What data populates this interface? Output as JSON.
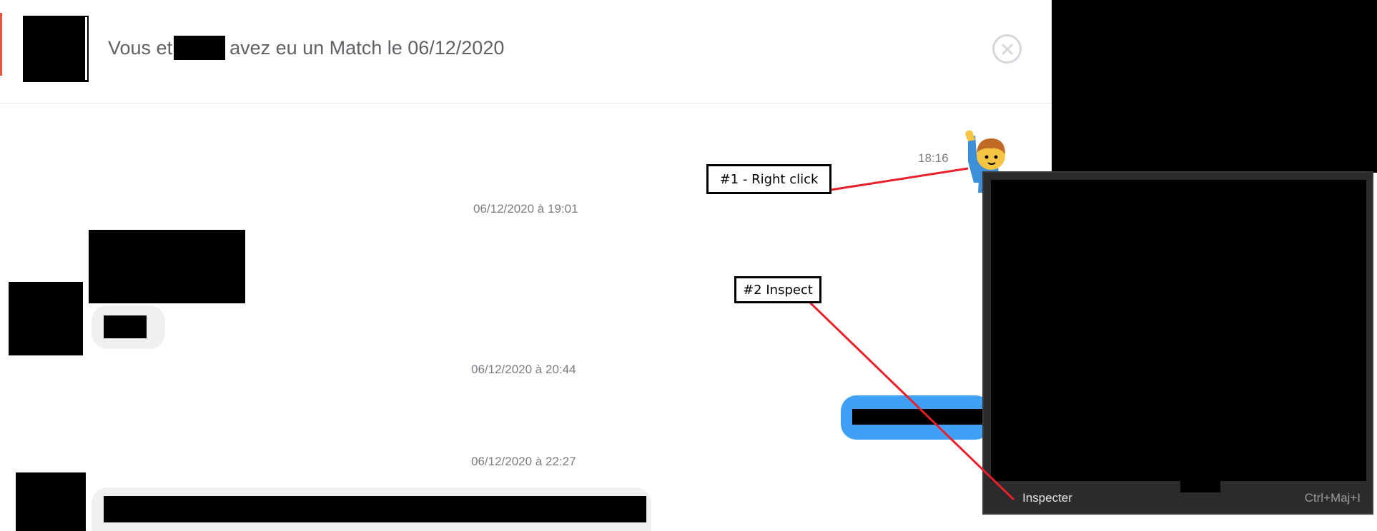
{
  "header": {
    "title_prefix": "Vous et",
    "title_suffix": "avez eu un Match le 06/12/2020"
  },
  "icons": {
    "close": "close-circle-icon",
    "wave": "person-raising-hand-emoji"
  },
  "messages": {
    "sent_time": "18:16",
    "ts1": "06/12/2020 à 19:01",
    "ts2": "06/12/2020 à 20:44",
    "ts3": "06/12/2020 à 22:27"
  },
  "context_menu": {
    "item_label": "Inspecter",
    "item_shortcut": "Ctrl+Maj+I"
  },
  "annotations": {
    "step1": "#1 - Right click",
    "step2": "#2 Inspect"
  },
  "colors": {
    "accent_red": "#e8533f",
    "bubble_blue": "#3fa0f5",
    "bubble_gray": "#f0f0f0",
    "menu_bg": "#2b2b2d",
    "arrow_red": "#e8202a"
  }
}
